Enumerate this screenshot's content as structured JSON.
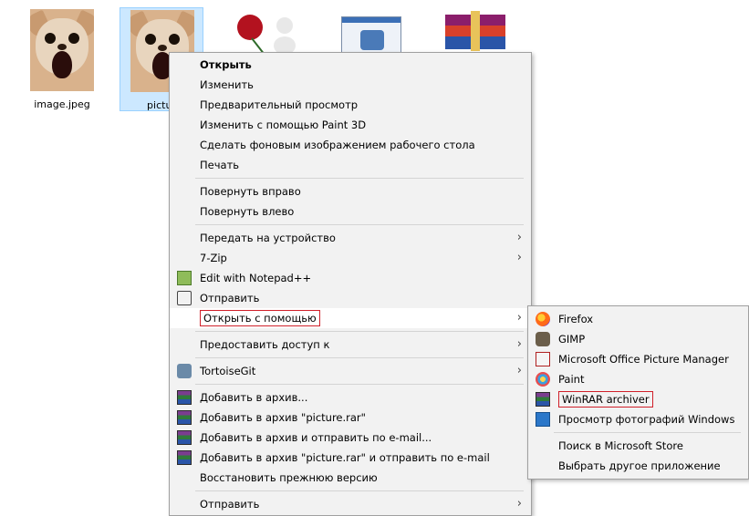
{
  "files": [
    {
      "name": "image.jpeg"
    },
    {
      "name": "pictur"
    },
    {
      "name": ""
    },
    {
      "name": ""
    },
    {
      "name": ""
    }
  ],
  "thumb_text": "Сделать фоновым изображением",
  "menu": {
    "items": [
      {
        "label": "Открыть"
      },
      {
        "label": "Изменить"
      },
      {
        "label": "Предварительный просмотр"
      },
      {
        "label": "Изменить с помощью Paint 3D"
      },
      {
        "label": "Сделать фоновым изображением рабочего стола"
      },
      {
        "label": "Печать"
      },
      {
        "label": "Повернуть вправо"
      },
      {
        "label": "Повернуть влево"
      },
      {
        "label": "Передать на устройство"
      },
      {
        "label": "7-Zip"
      },
      {
        "label": "Edit with Notepad++"
      },
      {
        "label": "Отправить"
      },
      {
        "label": "Открыть с помощью"
      },
      {
        "label": "Предоставить доступ к"
      },
      {
        "label": "TortoiseGit"
      },
      {
        "label": "Добавить в архив..."
      },
      {
        "label": "Добавить в архив \"picture.rar\""
      },
      {
        "label": "Добавить в архив и отправить по e-mail..."
      },
      {
        "label": "Добавить в архив \"picture.rar\" и отправить по e-mail"
      },
      {
        "label": "Восстановить прежнюю версию"
      },
      {
        "label": "Отправить"
      }
    ]
  },
  "submenu": {
    "items": [
      {
        "label": "Firefox"
      },
      {
        "label": "GIMP"
      },
      {
        "label": "Microsoft Office Picture Manager"
      },
      {
        "label": "Paint"
      },
      {
        "label": "WinRAR archiver"
      },
      {
        "label": "Просмотр фотографий Windows"
      },
      {
        "label": "Поиск в Microsoft Store"
      },
      {
        "label": "Выбрать другое приложение"
      }
    ]
  },
  "colors": {
    "highlight_box": "#d0202a",
    "selection": "#cce8ff",
    "menu_bg": "#f2f2f2"
  }
}
